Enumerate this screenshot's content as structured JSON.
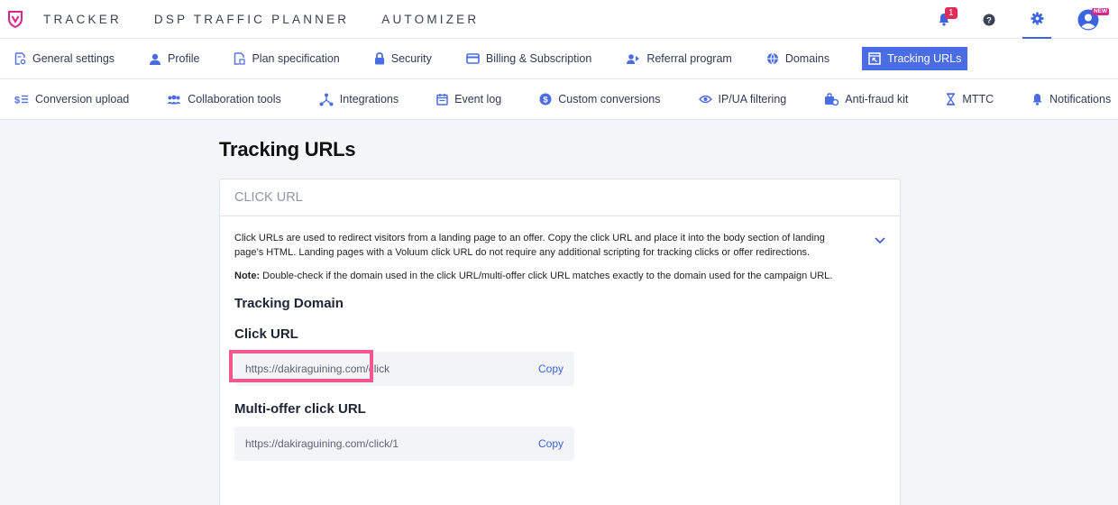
{
  "topnav": {
    "items": [
      "TRACKER",
      "DSP TRAFFIC PLANNER",
      "AUTOMIZER"
    ]
  },
  "notifications": {
    "count": "1"
  },
  "avatar": {
    "badge": "NEW"
  },
  "tabs_row1": [
    {
      "label": "General settings",
      "icon": "settings-doc-icon"
    },
    {
      "label": "Profile",
      "icon": "person-icon"
    },
    {
      "label": "Plan specification",
      "icon": "plan-doc-icon"
    },
    {
      "label": "Security",
      "icon": "lock-icon"
    },
    {
      "label": "Billing & Subscription",
      "icon": "credit-card-icon"
    },
    {
      "label": "Referral program",
      "icon": "referral-icon"
    },
    {
      "label": "Domains",
      "icon": "globe-icon"
    },
    {
      "label": "Tracking URLs",
      "icon": "tracking-url-icon",
      "active": true
    }
  ],
  "tabs_row2": [
    {
      "label": "Conversion upload",
      "icon": "dollar-list-icon"
    },
    {
      "label": "Collaboration tools",
      "icon": "team-icon"
    },
    {
      "label": "Integrations",
      "icon": "integration-icon"
    },
    {
      "label": "Event log",
      "icon": "calendar-icon"
    },
    {
      "label": "Custom conversions",
      "icon": "dollar-circle-icon"
    },
    {
      "label": "IP/UA filtering",
      "icon": "filter-eye-icon"
    },
    {
      "label": "Anti-fraud kit",
      "icon": "anti-fraud-icon"
    },
    {
      "label": "MTTC",
      "icon": "hourglass-icon"
    },
    {
      "label": "Notifications",
      "icon": "bell-icon"
    }
  ],
  "page": {
    "title": "Tracking URLs",
    "card_title": "CLICK URL",
    "description": "Click URLs are used to redirect visitors from a landing page to an offer. Copy the click URL and place it into the body section of landing page’s HTML. Landing pages with a Voluum click URL do not require any additional scripting for tracking clicks or offer redirections.",
    "note_label": "Note:",
    "note_text": " Double-check if the domain used in the click URL/multi-offer click URL matches exactly to the domain used for the campaign URL.",
    "tracking_domain_label": "Tracking Domain",
    "click_url_label": "Click URL",
    "click_url_value": "https://dakiraguining.com/click",
    "multi_offer_label": "Multi-offer click URL",
    "multi_offer_value": "https://dakiraguining.com/click/1",
    "copy_label": "Copy"
  },
  "colors": {
    "accent": "#4a6ce4",
    "highlight": "#f2578e",
    "badge": "#e02b57"
  }
}
